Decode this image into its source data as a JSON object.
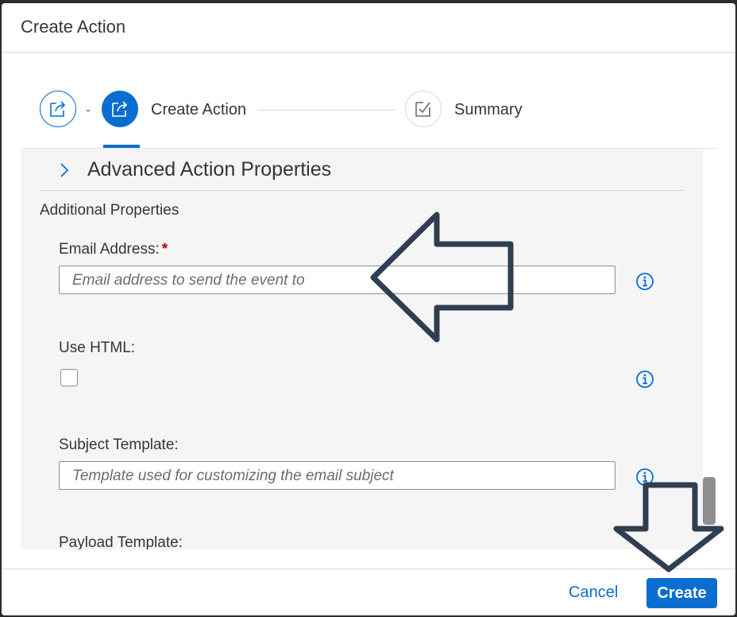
{
  "dialog": {
    "title": "Create Action"
  },
  "wizard": {
    "steps": [
      {
        "icon": "share-icon",
        "label": ""
      },
      {
        "icon": "share-icon",
        "label": "Create Action"
      },
      {
        "icon": "checkbox-icon",
        "label": "Summary"
      }
    ],
    "separator": "-"
  },
  "section": {
    "title": "Advanced Action Properties",
    "group_title": "Additional Properties"
  },
  "fields": {
    "email": {
      "label": "Email Address:",
      "required_marker": "*",
      "placeholder": "Email address to send the event to",
      "value": ""
    },
    "use_html": {
      "label": "Use HTML:",
      "checked": false
    },
    "subject": {
      "label": "Subject Template:",
      "placeholder": "Template used for customizing the email subject",
      "value": ""
    },
    "payload": {
      "label": "Payload Template:"
    }
  },
  "footer": {
    "cancel_label": "Cancel",
    "create_label": "Create"
  },
  "colors": {
    "accent": "#0a6ed1",
    "required": "#bb0000",
    "annotation_arrow": "#2f3e50"
  }
}
